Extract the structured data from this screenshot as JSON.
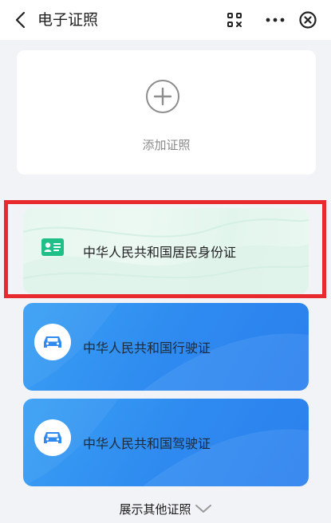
{
  "nav": {
    "title": "电子证照"
  },
  "add_card": {
    "label": "添加证照"
  },
  "certificates": [
    {
      "name": "中华人民共和国居民身份证",
      "icon": "id-card-icon"
    },
    {
      "name": "中华人民共和国行驶证",
      "icon": "car-icon"
    },
    {
      "name": "中华人民共和国驾驶证",
      "icon": "car-icon"
    }
  ],
  "footer": {
    "show_more": "展示其他证照"
  },
  "colors": {
    "highlight": "#e82a2f",
    "id_icon": "#1fbf87",
    "license_blue": "#2f8bf0"
  }
}
